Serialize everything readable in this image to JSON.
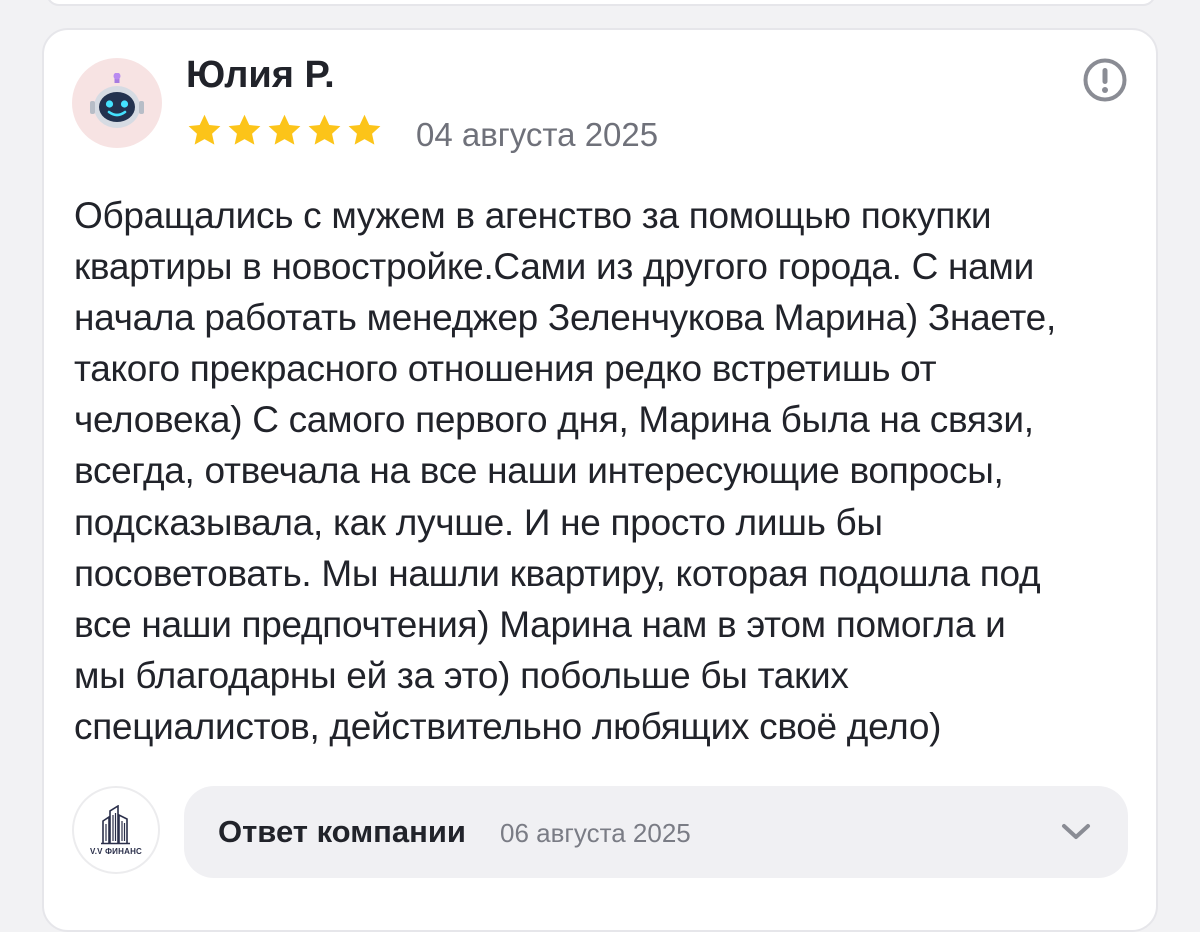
{
  "review": {
    "author": "Юлия Р.",
    "rating": 5,
    "rating_max": 5,
    "date": "04 августа 2025",
    "text_lines": [
      "Обращались с мужем в агенство за помощью покупки",
      "квартиры в новостройке.Сами из другого города. С нами",
      "начала работать менеджер Зеленчукова Марина) Знаете,",
      "такого прекрасного отношения редко встретишь от",
      "человека) С самого первого дня, Марина была на связи,",
      "всегда, отвечала на все наши интересующие вопросы,",
      "подсказывала, как лучше. И не просто лишь бы",
      "посоветовать. Мы нашли квартиру, которая подошла под",
      "все наши предпочтения) Марина нам в этом помогла и",
      "мы благодарны ей за это) побольше бы таких",
      "специалистов, действительно любящих своё дело)"
    ],
    "avatar_icon": "robot-avatar-icon",
    "star_color": "#fcc419"
  },
  "company_reply": {
    "title": "Ответ компании",
    "date": "06 августа 2025",
    "logo_text": "V.V ФИНАНС",
    "logo_icon": "building-logo-icon",
    "expand_icon": "chevron-down-icon"
  },
  "colors": {
    "accent_text": "#21232a",
    "muted_text": "#6f717a",
    "info_icon": "#8a8c94"
  }
}
